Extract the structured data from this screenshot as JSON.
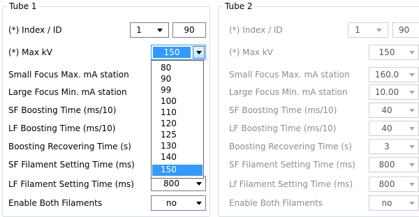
{
  "tube1": {
    "title": "Tube 1",
    "index_label": "(*) Index / ID",
    "index_value": "1",
    "id_value": "90",
    "maxkv_label": "(*) Max kV",
    "maxkv_value": "150",
    "labels": {
      "small_focus": "Small Focus Max. mA station",
      "large_focus": "Large Focus Min. mA station",
      "sf_boost": "SF Boosting Time (ms/10)",
      "lf_boost": "LF Boosting Time (ms/10)",
      "boost_recover": "Boosting Recovering Time (s)",
      "sf_filament": "SF Filament Setting Time (ms)",
      "lf_filament": "LF Filament Setting Time (ms)",
      "enable_both": "Enable Both Filaments"
    },
    "lf_filament_value": "800",
    "enable_both_value": "no",
    "dropdown_options": [
      "80",
      "90",
      "99",
      "100",
      "110",
      "120",
      "125",
      "130",
      "140",
      "150"
    ],
    "dropdown_selected": "150"
  },
  "tube2": {
    "title": "Tube 2",
    "index_label": "(*) Index / ID",
    "index_value": "1",
    "id_value": "90",
    "maxkv_label": "(*) Max kV",
    "maxkv_value": "150",
    "labels": {
      "small_focus": "Small Focus Max. mA station",
      "large_focus": "Large Focus Min. mA station",
      "sf_boost": "SF Boosting Time (ms/10)",
      "lf_boost": "LF Boosting Time (ms/10)",
      "boost_recover": "Boosting Recovering Time (s)",
      "sf_filament": "SF Filament Setting Time (ms)",
      "lf_filament": "Lf Filament Setting Time (ms)",
      "enable_both": "Enable Both Filaments"
    },
    "values": {
      "small_focus": "160.0",
      "large_focus": "10.00",
      "sf_boost": "40",
      "lf_boost": "40",
      "boost_recover": "3",
      "sf_filament": "800",
      "lf_filament": "800",
      "enable_both": "no"
    }
  }
}
